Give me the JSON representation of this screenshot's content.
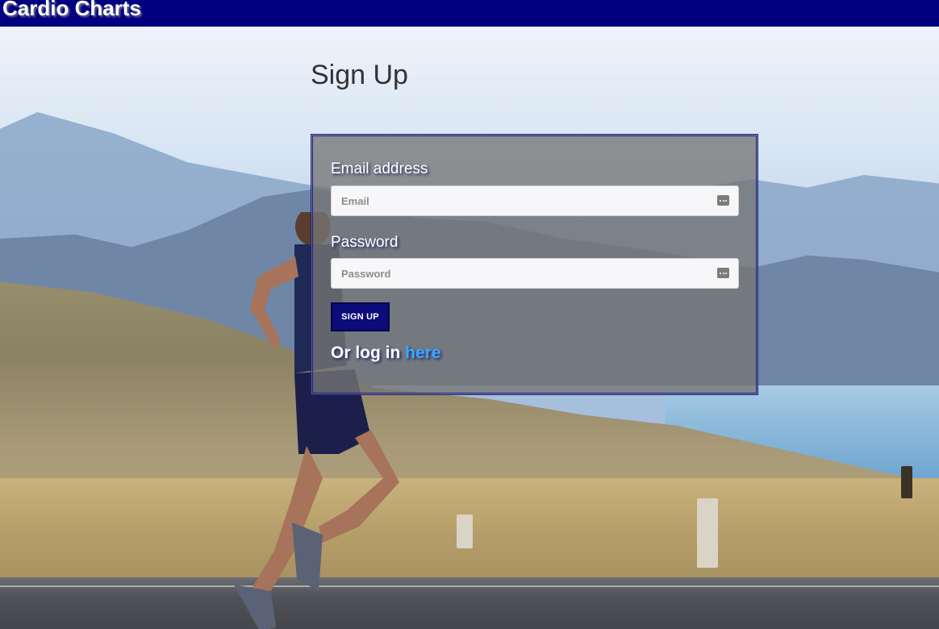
{
  "header": {
    "brand": "Cardio Charts"
  },
  "page": {
    "title": "Sign Up"
  },
  "form": {
    "email_label": "Email address",
    "email_placeholder": "Email",
    "password_label": "Password",
    "password_placeholder": "Password",
    "submit_label": "SIGN UP",
    "login_prefix": "Or log in",
    "login_link": "here"
  },
  "colors": {
    "header_bg": "#000080",
    "button_bg": "#0b0b7a",
    "link": "#39a9ff",
    "panel_border": "#1d1f8a"
  },
  "icons": {
    "input_trailing": "password-manager-key-icon"
  }
}
